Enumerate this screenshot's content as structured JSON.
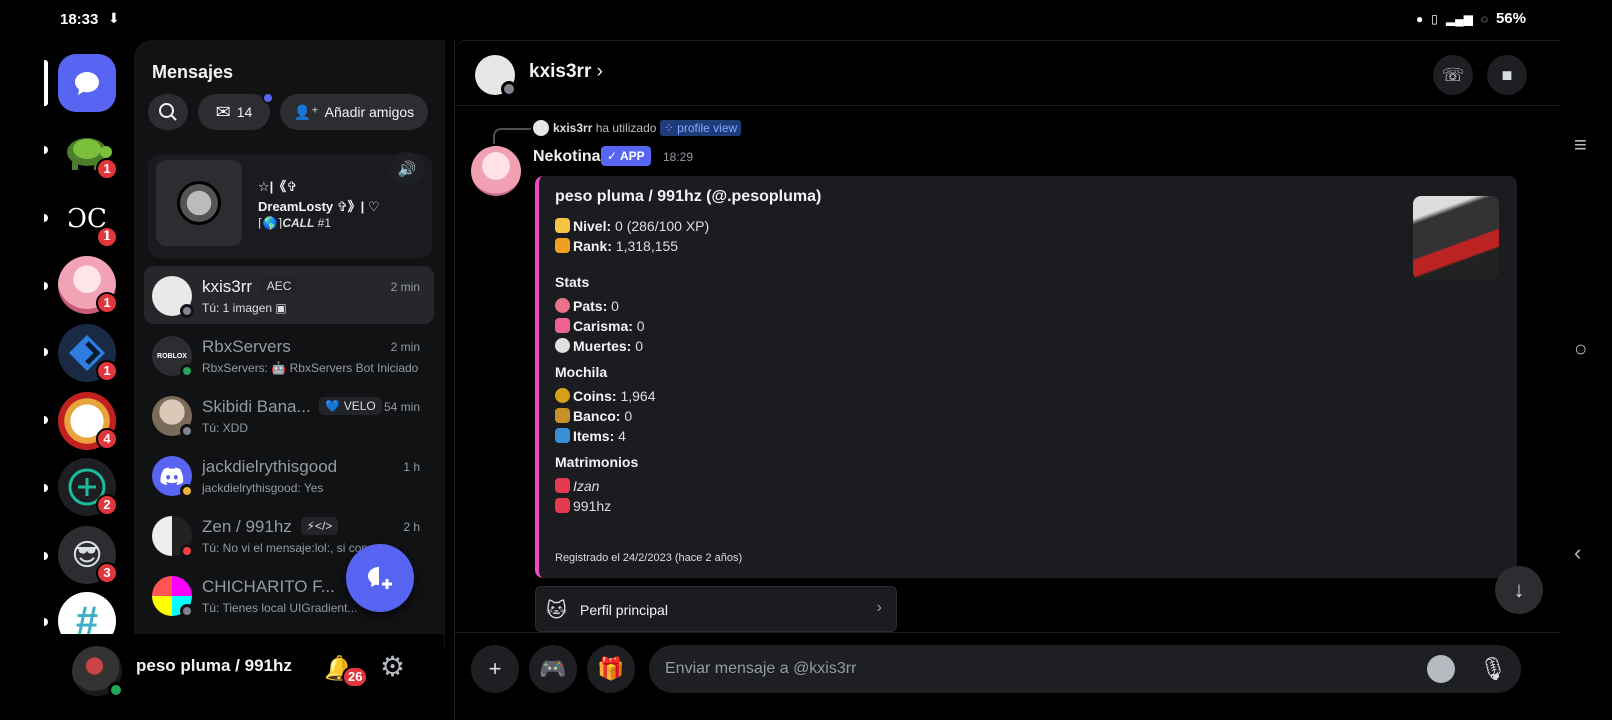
{
  "status_bar": {
    "time": "18:33",
    "battery": "56%"
  },
  "servers": {
    "badges": [
      "1",
      "1",
      "1",
      "1",
      "4",
      "2",
      "3"
    ],
    "text_logo": "ƆC"
  },
  "dm_panel": {
    "title": "Mensajes",
    "inbox_count": "14",
    "add_friends_label": "Añadir amigos",
    "activity": {
      "line1": "☆|《✞",
      "line2": "DreamLosty ✞》| ♡",
      "line3": "⌈🌎⌉",
      "line3_italic": "CALL",
      "line3_tail": " #1"
    },
    "conversations": [
      {
        "name": "kxis3rr",
        "tag": "AEC",
        "time": "2 min",
        "preview": "Tú: 1 imagen ▣"
      },
      {
        "name": "RbxServers",
        "tag": "",
        "time": "2 min",
        "preview": "RbxServers: 🤖 RbxServers Bot Iniciado"
      },
      {
        "name": "Skibidi Bana...",
        "tag": "💙 VELO",
        "time": "54 min",
        "preview": "Tú: XDD"
      },
      {
        "name": "jackdielrythisgood",
        "tag": "",
        "time": "1 h",
        "preview": "jackdielrythisgood: Yes"
      },
      {
        "name": "Zen / 991hz",
        "tag": "⚡</>",
        "time": "2 h",
        "preview": "Tú: No vi el mensaje:lol:, si con est"
      },
      {
        "name": "CHICHARITO F...",
        "tag": "",
        "time": "",
        "preview": "Tú: Tienes local UIGradient..."
      }
    ]
  },
  "user_bar": {
    "name": "peso pluma / 991hz",
    "notification_count": "26"
  },
  "chat": {
    "header_name": "kxis3rr",
    "reply": {
      "user": "kxis3rr",
      "text": " ha utilizado ",
      "command": "⁘ profile view"
    },
    "bot": {
      "name": "Nekotina",
      "tag": "✓ APP",
      "time": "18:29"
    },
    "embed": {
      "title": "peso pluma / 991hz (@.pesopluma)",
      "nivel_label": "Nivel:",
      "nivel_value": " 0 (286/100 XP)",
      "rank_label": "Rank:",
      "rank_value": " 1,318,155",
      "stats_heading": "Stats",
      "pats_label": "Pats:",
      "pats_value": " 0",
      "carisma_label": "Carisma:",
      "carisma_value": " 0",
      "muertes_label": "Muertes:",
      "muertes_value": " 0",
      "mochila_heading": "Mochila",
      "coins_label": "Coins:",
      "coins_value": " 1,964",
      "banco_label": "Banco:",
      "banco_value": " 0",
      "items_label": "Items:",
      "items_value": " 4",
      "matrimonios_heading": "Matrimonios",
      "spouse1": "Izan",
      "spouse2": "991hz",
      "footer": "Registrado el 24/2/2023 (hace 2 años)"
    },
    "profile_button": "Perfil principal",
    "composer_placeholder": "Enviar mensaje a @kxis3rr"
  },
  "colors": {
    "blurple": "#5865f2",
    "embed_accent": "#ed4abf",
    "online": "#23a55a",
    "badge_red": "#e0363c"
  }
}
